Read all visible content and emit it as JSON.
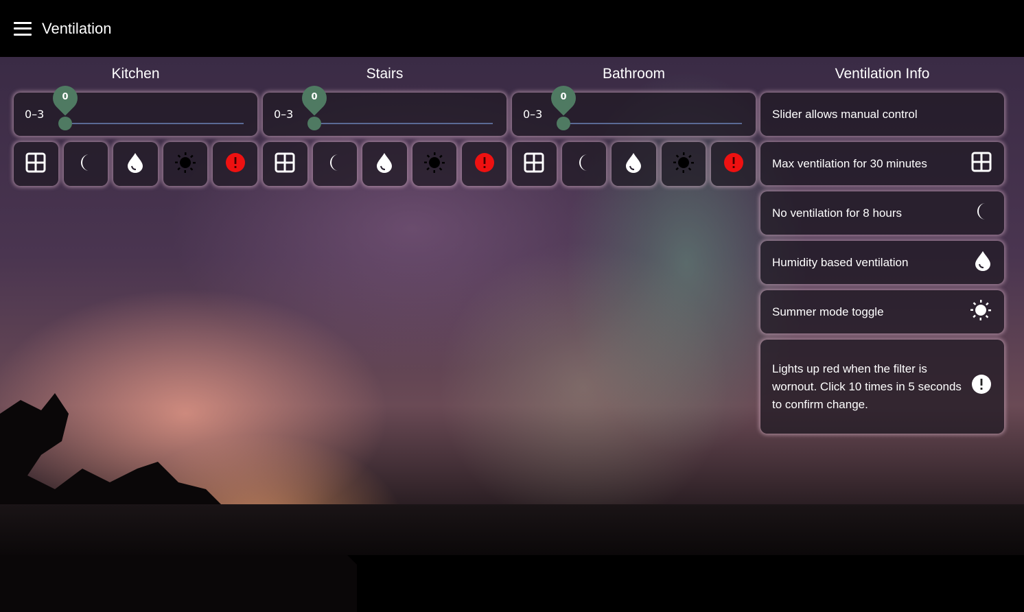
{
  "header": {
    "title": "Ventilation",
    "menu_icon": "hamburger-menu-icon"
  },
  "rooms": [
    {
      "name": "Kitchen",
      "range": "0–3",
      "value": "0",
      "min": 0,
      "max": 3
    },
    {
      "name": "Stairs",
      "range": "0–3",
      "value": "0",
      "min": 0,
      "max": 3
    },
    {
      "name": "Bathroom",
      "range": "0–3",
      "value": "0",
      "min": 0,
      "max": 3
    }
  ],
  "buttons": [
    "max-ventilation-icon",
    "moon-icon",
    "humidity-drop-icon",
    "sun-icon",
    "filter-alert-icon"
  ],
  "colors": {
    "slider": "#4f7a62",
    "track": "#5a6a95",
    "alert": "#ee1111"
  },
  "info": {
    "title": "Ventilation Info",
    "items": [
      {
        "text": "Slider allows manual control",
        "icon": ""
      },
      {
        "text": "Max ventilation for 30 minutes",
        "icon": "max-ventilation-icon"
      },
      {
        "text": "No ventilation for 8 hours",
        "icon": "moon-icon"
      },
      {
        "text": "Humidity based ventilation",
        "icon": "humidity-drop-icon"
      },
      {
        "text": "Summer mode toggle",
        "icon": "sun-icon"
      },
      {
        "text": "Lights up red when the filter is wornout. Click 10 times in 5 seconds to confirm change.",
        "icon": "exclamation-icon"
      }
    ]
  }
}
